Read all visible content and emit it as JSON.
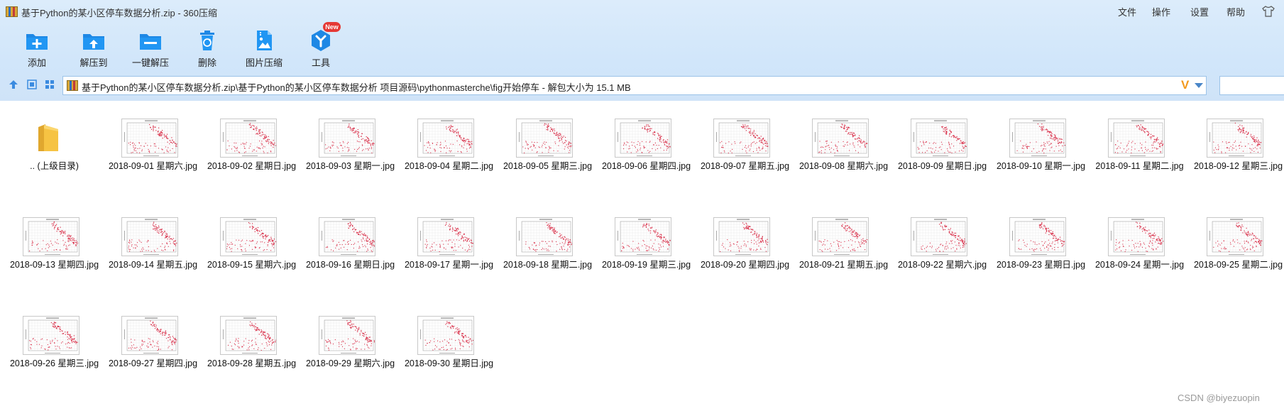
{
  "window": {
    "title": "基于Python的某小区停车数据分析.zip - 360压缩",
    "menu": [
      "文件",
      "操作",
      "设置",
      "帮助"
    ]
  },
  "toolbar": {
    "items": [
      {
        "label": "添加",
        "icon": "add-icon"
      },
      {
        "label": "解压到",
        "icon": "extract-to-icon"
      },
      {
        "label": "一键解压",
        "icon": "one-click-extract-icon"
      },
      {
        "label": "删除",
        "icon": "delete-icon"
      },
      {
        "label": "图片压缩",
        "icon": "image-compress-icon"
      },
      {
        "label": "工具",
        "icon": "tools-icon"
      }
    ],
    "new_badge": "New"
  },
  "address": {
    "path": "基于Python的某小区停车数据分析.zip\\基于Python的某小区停车数据分析 项目源码\\pythonmasterche\\fig开始停车 - 解包大小为 15.1 MB",
    "search_placeholder": ""
  },
  "files": [
    {
      "name": ".. (上级目录)",
      "type": "parent-folder"
    },
    {
      "name": "2018-09-01 星期六.jpg",
      "type": "image"
    },
    {
      "name": "2018-09-02 星期日.jpg",
      "type": "image"
    },
    {
      "name": "2018-09-03 星期一.jpg",
      "type": "image"
    },
    {
      "name": "2018-09-04 星期二.jpg",
      "type": "image"
    },
    {
      "name": "2018-09-05 星期三.jpg",
      "type": "image"
    },
    {
      "name": "2018-09-06 星期四.jpg",
      "type": "image"
    },
    {
      "name": "2018-09-07 星期五.jpg",
      "type": "image"
    },
    {
      "name": "2018-09-08 星期六.jpg",
      "type": "image"
    },
    {
      "name": "2018-09-09 星期日.jpg",
      "type": "image"
    },
    {
      "name": "2018-09-10 星期一.jpg",
      "type": "image"
    },
    {
      "name": "2018-09-11 星期二.jpg",
      "type": "image"
    },
    {
      "name": "2018-09-12 星期三.jpg",
      "type": "image"
    },
    {
      "name": "2018-09-13 星期四.jpg",
      "type": "image"
    },
    {
      "name": "2018-09-14 星期五.jpg",
      "type": "image"
    },
    {
      "name": "2018-09-15 星期六.jpg",
      "type": "image"
    },
    {
      "name": "2018-09-16 星期日.jpg",
      "type": "image"
    },
    {
      "name": "2018-09-17 星期一.jpg",
      "type": "image"
    },
    {
      "name": "2018-09-18 星期二.jpg",
      "type": "image"
    },
    {
      "name": "2018-09-19 星期三.jpg",
      "type": "image"
    },
    {
      "name": "2018-09-20 星期四.jpg",
      "type": "image"
    },
    {
      "name": "2018-09-21 星期五.jpg",
      "type": "image"
    },
    {
      "name": "2018-09-22 星期六.jpg",
      "type": "image"
    },
    {
      "name": "2018-09-23 星期日.jpg",
      "type": "image"
    },
    {
      "name": "2018-09-24 星期一.jpg",
      "type": "image"
    },
    {
      "name": "2018-09-25 星期二.jpg",
      "type": "image"
    },
    {
      "name": "2018-09-26 星期三.jpg",
      "type": "image"
    },
    {
      "name": "2018-09-27 星期四.jpg",
      "type": "image"
    },
    {
      "name": "2018-09-28 星期五.jpg",
      "type": "image"
    },
    {
      "name": "2018-09-29 星期六.jpg",
      "type": "image"
    },
    {
      "name": "2018-09-30 星期日.jpg",
      "type": "image"
    }
  ],
  "watermark": "CSDN @biyezuopin",
  "colors": {
    "accent": "#2196f3",
    "toolbar_bg": "#d6e8fa",
    "scatter_point": "#d9304a",
    "new_badge": "#e53935",
    "address_arrow": "#f39a1e"
  }
}
